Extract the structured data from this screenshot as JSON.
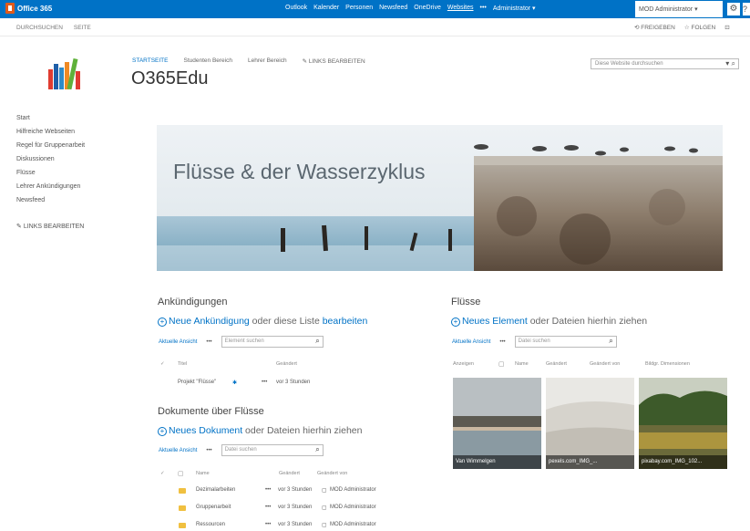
{
  "suite": {
    "logo_text": "Office 365",
    "nav": [
      "Outlook",
      "Kalender",
      "Personen",
      "Newsfeed",
      "OneDrive",
      "Websites",
      "•••",
      "Administrator ▾"
    ],
    "active_index": 5,
    "user": "MOD Administrator ▾",
    "colors": {
      "bar": "#0072c6"
    }
  },
  "ribbon": {
    "tabs": [
      "DURCHSUCHEN",
      "SEITE"
    ],
    "share": "FREIGEBEN",
    "follow": "FOLGEN"
  },
  "topnav": [
    "STARTSEITE",
    "Studenten Bereich",
    "Lehrer Bereich",
    "LINKS BEARBEITEN"
  ],
  "site_title": "O365Edu",
  "search": {
    "placeholder": "Diese Website durchsuchen"
  },
  "leftnav": [
    "Start",
    "Hilfreiche Webseiten",
    "Regel für Gruppenarbeit",
    "Diskussionen",
    "Flüsse",
    "Lehrer Ankündigungen",
    "Newsfeed"
  ],
  "leftnav_edit": "LINKS BEARBEITEN",
  "hero": {
    "title": "Flüsse & der Wasserzyklus"
  },
  "announcements": {
    "title": "Ankündigungen",
    "cta_new": "Neue Ankündigung",
    "cta_mid": " oder diese Liste ",
    "cta_edit": "bearbeiten",
    "view": "Aktuelle Ansicht",
    "dots": "•••",
    "find": "Element suchen",
    "columns": [
      "✓",
      "Titel",
      "Geändert"
    ],
    "row": {
      "title": "Projekt \"Flüsse\"",
      "new": "✱",
      "dots": "•••",
      "modified": "vor 3 Stunden"
    }
  },
  "documents": {
    "title": "Dokumente über Flüsse",
    "cta_new": "Neues Dokument",
    "cta_rest": " oder Dateien hierhin ziehen",
    "view": "Aktuelle Ansicht",
    "dots": "•••",
    "find": "Datei suchen",
    "columns": [
      "✓",
      "▢",
      "Name",
      "Geändert",
      "Geändert von"
    ],
    "rows": [
      {
        "name": "Dezimalarbeiten",
        "dots": "•••",
        "modified": "vor 3 Stunden",
        "by": "MOD Administrator"
      },
      {
        "name": "Gruppenarbeit",
        "dots": "•••",
        "modified": "vor 3 Stunden",
        "by": "MOD Administrator"
      },
      {
        "name": "Ressourcen",
        "dots": "•••",
        "modified": "vor 3 Stunden",
        "by": "MOD Administrator"
      }
    ]
  },
  "rivers": {
    "title": "Flüsse",
    "cta_new": "Neues Element",
    "cta_rest": " oder Dateien hierhin ziehen",
    "view": "Aktuelle Ansicht",
    "dots": "•••",
    "find": "Datei suchen",
    "columns": [
      "Anzeigen",
      "▢",
      "Name",
      "Geändert",
      "Geändert von",
      "Bildgr. Dimensionen"
    ],
    "tiles": [
      "Van Wimmelgen",
      "pexels.com_IMG_...",
      "pixabay.com_IMG_102..."
    ]
  }
}
